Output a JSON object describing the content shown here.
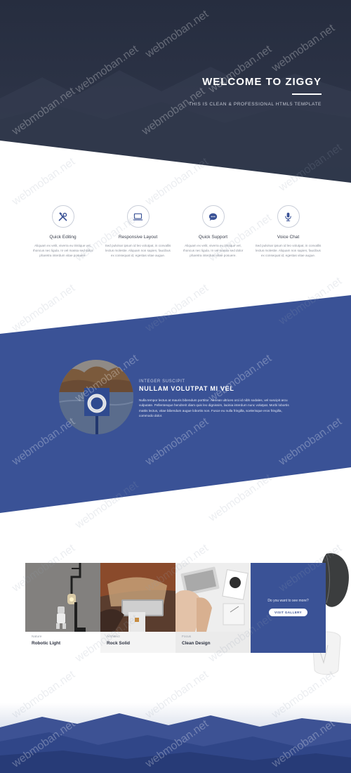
{
  "hero": {
    "title": "WELCOME TO ZIGGY",
    "subtitle": "THIS IS CLEAN & PROFESSIONAL HTML5 TEMPLATE"
  },
  "features": [
    {
      "icon": "tools-icon",
      "title": "Quick Editing",
      "text": "Aliquam ex velit, viverra eu tristique vel, rhoncus nec ligula. In vel massa sed dolor pharetra interdum vitae posuere."
    },
    {
      "icon": "laptop-icon",
      "title": "Responsive Layout",
      "text": "Sed pulvinar ipsum id leo volutpat, in convallis lectus molestie. Aliquam non sapien, faucibus ex consequat id, egestas vitae augue."
    },
    {
      "icon": "chat-icon",
      "title": "Quick Support",
      "text": "Aliquam ex velit, viverra eu tristique vel, rhoncus nec ligula. In vel massa sed dolor pharetra interdum vitae posuere."
    },
    {
      "icon": "microphone-icon",
      "title": "Voice Chat",
      "text": "Sed pulvinar ipsum id leo volutpat, in convallis lectus molestie. Aliquam non sapien, faucibus ex consequat id, egestas vitae augue."
    }
  ],
  "about": {
    "overline": "INTEGER SUSCIPIT",
    "title": "NULLAM VOLUTPAT MI VEL",
    "text": "Nulla tempor lectus at mauris bibendum porttitor. Aenean ultrices orci id nibh sodales, vel suscipit arcu vulputate. Pellentesque hendrerit diam quis leo dignissim, lacinia interdum nunc volutpat. Morbi lobortis mattis lectus, vitae bibendum augue lobortis non. Fusce eu nulla fringilla, scelerisque eros fringilla, commodo dolor."
  },
  "gallery": {
    "items": [
      {
        "category": "Nature",
        "title": "Robotic Light"
      },
      {
        "category": "Architect",
        "title": "Rock Solid"
      },
      {
        "category": "Focus",
        "title": "Clean Design"
      }
    ],
    "cta_text": "Do you want to see more?",
    "cta_button": "VISIT GALLERY"
  },
  "watermark": "webmoban.net",
  "colors": {
    "hero_bg": "#2b3245",
    "accent_blue": "#3a5296",
    "text_dark": "#2c3140",
    "text_muted": "#8b909b"
  }
}
